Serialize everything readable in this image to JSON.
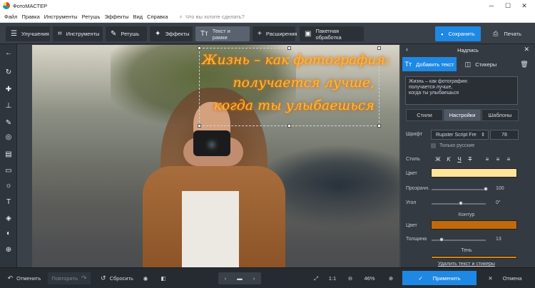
{
  "title_bar": {
    "app_name": "ФотоМАСТЕР",
    "minimize": "─",
    "maximize": "☐",
    "close": "✕"
  },
  "menu": {
    "items": [
      "Файл",
      "Правка",
      "Инструменты",
      "Ретушь",
      "Эффекты",
      "Вид",
      "Справка"
    ],
    "search_placeholder": "Что вы хотите сделать?"
  },
  "toolbar": {
    "tabs": [
      {
        "label": "Улучшения",
        "icon": "sliders-icon"
      },
      {
        "label": "Инструменты",
        "icon": "crop-icon"
      },
      {
        "label": "Ретушь",
        "icon": "brush-icon"
      },
      {
        "label": "Эффекты",
        "icon": "magic-wand-icon"
      },
      {
        "label": "Текст и рамки",
        "icon": "text-icon"
      },
      {
        "label": "Расширения",
        "icon": "plus-icon"
      },
      {
        "label": "Пакетная обработка",
        "icon": "batch-icon"
      }
    ],
    "active_tab": "Текст и рамки",
    "save_label": "Сохранить",
    "print_label": "Печать"
  },
  "canvas": {
    "text_lines": [
      "Жизнь – как фотография:",
      "получается лучше,",
      "когда ты улыбаешься"
    ]
  },
  "panel": {
    "title": "Надпись",
    "tabs": {
      "add_text": "Добавить текст",
      "stickers": "Стикеры"
    },
    "text_value": "Жизнь – как фотография:\nполучается лучше,\nкогда ты улыбаешься",
    "subtabs": [
      "Стили",
      "Настройки",
      "Шаблоны"
    ],
    "active_subtab": "Настройки",
    "font_label": "Шрифт",
    "font_value": "Rupster Script Fre",
    "font_size": "78",
    "only_russian": "Только русские",
    "style_label": "Стиль",
    "color_label": "Цвет",
    "text_color": "#ffe49a",
    "opacity_label": "Прозрачн.",
    "opacity_value": "100",
    "angle_label": "Угол",
    "angle_value": "0°",
    "outline_section": "Контур",
    "outline_color_label": "Цвет",
    "outline_color": "#c06a0a",
    "thickness_label": "Толщина",
    "thickness_value": "13",
    "shadow_section": "Тень",
    "shadow_color": "#d98412",
    "remove_link": "Удалить текст и стикеры",
    "apply_label": "Применить",
    "cancel_label": "Отмена"
  },
  "bottom": {
    "undo": "Отменить",
    "redo": "Повторить",
    "reset": "Сбросить",
    "zoom_ratio": "1:1",
    "zoom_percent": "46%"
  },
  "colors": {
    "accent": "#1e88e5"
  }
}
